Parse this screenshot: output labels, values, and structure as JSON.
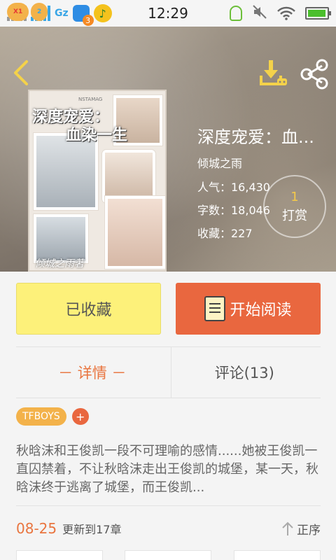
{
  "status_bar": {
    "time": "12:29",
    "sim1_tag": "X1",
    "sim2_tag": "2",
    "network_label": "Gz",
    "notification_count": "3",
    "icons": [
      "signal-icon",
      "signal-icon",
      "app-notification-icon",
      "music-icon",
      "bulb-icon",
      "mute-icon",
      "wifi-icon",
      "battery-icon"
    ],
    "battery_level": 0.95
  },
  "header": {
    "back_icon": "back-chevron-icon",
    "download_icon": "download-icon",
    "share_icon": "share-icon"
  },
  "book": {
    "title": "深度宠爱：血...",
    "author": "倾城之雨",
    "popularity": "人气：16,430",
    "word_count": "字数：18,046",
    "favorites": "收藏：227",
    "cover_title_line1": "深度宠爱：",
    "cover_title_line2": "血染一生",
    "cover_brand": "NSTAMAG",
    "cover_author": "倾城之雨著"
  },
  "tip": {
    "count": "1",
    "label": "打赏"
  },
  "actions": {
    "collected_label": "已收藏",
    "read_label": "开始阅读"
  },
  "tabs": [
    {
      "label": "－ 详情 －",
      "active": true
    },
    {
      "label": "评论(13)",
      "active": false
    }
  ],
  "tags": {
    "items": [
      "TFBOYS"
    ],
    "add_label": "+"
  },
  "description": "秋晗沫和王俊凯一段不可理喻的感情......她被王俊凯一直囚禁着，不让秋晗沫走出王俊凯的城堡，某一天，秋晗沫终于逃离了城堡，而王俊凯...",
  "update": {
    "date": "08-25",
    "text": "更新到17章",
    "sort_label": "正序"
  },
  "colors": {
    "accent": "#e9673f",
    "collected_bg": "#fdf17a",
    "tag_bg": "#f3b24a",
    "tip_count": "#f4c94a"
  }
}
